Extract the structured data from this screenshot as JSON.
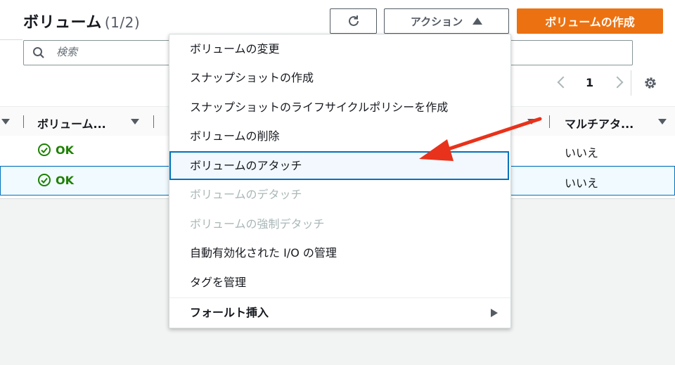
{
  "header": {
    "title": "ボリューム",
    "count": "(1/2)"
  },
  "toolbar": {
    "actions_label": "アクション",
    "create_label": "ボリュームの作成"
  },
  "search": {
    "placeholder": "検索"
  },
  "pagination": {
    "page": "1"
  },
  "table": {
    "headers": {
      "volume": "ボリューム...",
      "multi_attach": "マルチアタ..."
    },
    "rows": [
      {
        "status": "OK",
        "multi_attach": "いいえ",
        "selected": false
      },
      {
        "status": "OK",
        "multi_attach": "いいえ",
        "selected": true
      }
    ]
  },
  "menu": {
    "items": [
      {
        "label": "ボリュームの変更",
        "disabled": false
      },
      {
        "label": "スナップショットの作成",
        "disabled": false
      },
      {
        "label": "スナップショットのライフサイクルポリシーを作成",
        "disabled": false
      },
      {
        "label": "ボリュームの削除",
        "disabled": false
      },
      {
        "label": "ボリュームのアタッチ",
        "disabled": false,
        "highlighted": true
      },
      {
        "label": "ボリュームのデタッチ",
        "disabled": true
      },
      {
        "label": "ボリュームの強制デタッチ",
        "disabled": true
      },
      {
        "label": "自動有効化された I/O の管理",
        "disabled": false
      },
      {
        "label": "タグを管理",
        "disabled": false
      },
      {
        "label": "フォールト挿入",
        "disabled": false,
        "submenu": true
      }
    ]
  },
  "colors": {
    "primary": "#ec7211",
    "success": "#1d8102",
    "selected": "#0073bb",
    "annotation": "#e8321b"
  },
  "icons": [
    "refresh-icon",
    "caret-up-icon",
    "search-icon",
    "chevron-left-icon",
    "chevron-right-icon",
    "settings-gear-icon",
    "sort-down-icon",
    "status-ok-icon",
    "submenu-arrow-icon",
    "annotation-arrow"
  ]
}
